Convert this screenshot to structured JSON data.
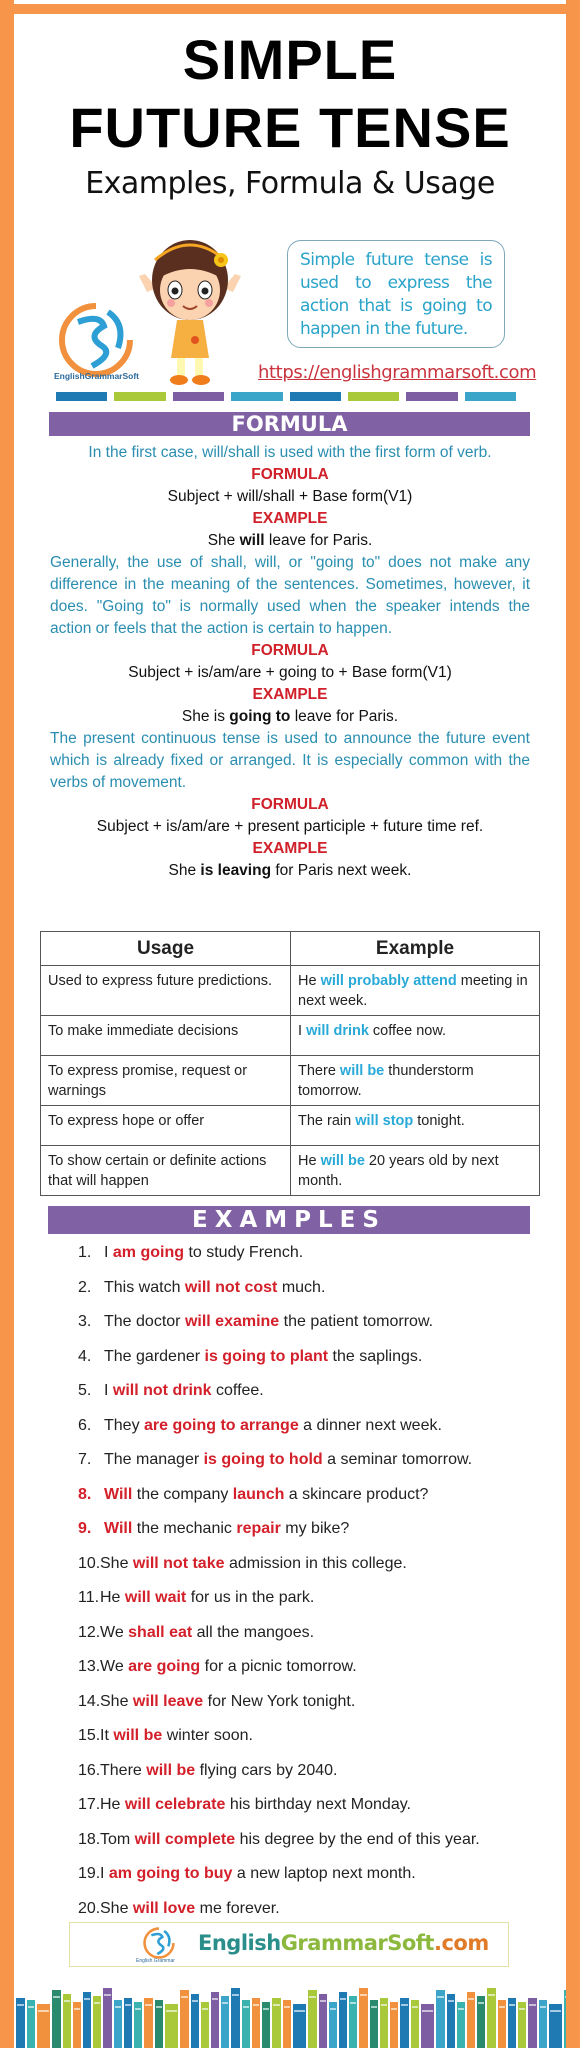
{
  "header": {
    "title_line1": "SIMPLE",
    "title_line2": "FUTURE TENSE",
    "subtitle": "Examples, Formula & Usage"
  },
  "intro": {
    "logo_text": "EnglishGrammarSoft",
    "definition": "Simple future tense is used to express the action that is going to happen in the future.",
    "url": "https://englishgrammarsoft.com",
    "icons": [
      "logo-icon",
      "girl-illustration-icon"
    ]
  },
  "formula_section": {
    "heading": "FORMULA",
    "blocks": [
      {
        "description": "In the first case, will/shall is used with the first form of verb.",
        "formula_label": "FORMULA",
        "formula": "Subject + will/shall + Base form(V1)",
        "example_label": "EXAMPLE",
        "example_parts": [
          "She ",
          "will",
          " leave for Paris."
        ]
      },
      {
        "description": "Generally, the use of shall, will, or \"going to\" does not make any difference in the meaning of the sentences. Sometimes, however, it does. \"Going to\" is normally used when the speaker intends the action or feels that the action is certain to happen.",
        "formula_label": "FORMULA",
        "formula": "Subject + is/am/are + going to + Base form(V1)",
        "example_label": "EXAMPLE",
        "example_parts": [
          "She is ",
          "going to",
          " leave for Paris."
        ]
      },
      {
        "description": "The present continuous tense is used to announce the future event which is already fixed or arranged. It is especially common with the verbs of movement.",
        "formula_label": "FORMULA",
        "formula": "Subject + is/am/are + present participle + future time ref.",
        "example_label": "EXAMPLE",
        "example_parts": [
          "She ",
          "is leaving",
          " for Paris next week."
        ]
      }
    ]
  },
  "usage_table": {
    "headers": [
      "Usage",
      "Example"
    ],
    "rows": [
      {
        "usage": "Used to express future predictions.",
        "example_parts": [
          "He ",
          "will probably attend",
          " meeting in next week."
        ]
      },
      {
        "usage": "To make immediate decisions",
        "example_parts": [
          "I ",
          "will drink",
          " coffee now."
        ]
      },
      {
        "usage": "To express promise, request or warnings",
        "example_parts": [
          "There ",
          "will be",
          " thunderstorm tomorrow."
        ]
      },
      {
        "usage": "To express hope or offer",
        "example_parts": [
          "The rain ",
          "will stop",
          " tonight."
        ]
      },
      {
        "usage": "To show certain or definite actions that will happen",
        "example_parts": [
          "He ",
          "will be",
          " 20 years old by next month."
        ]
      }
    ]
  },
  "examples_section": {
    "heading": "EXAMPLES",
    "items": [
      {
        "num": "1.",
        "parts": [
          "I ",
          "am going",
          " to study French."
        ]
      },
      {
        "num": "2.",
        "parts": [
          "This watch ",
          "will not cost",
          " much."
        ]
      },
      {
        "num": "3.",
        "parts": [
          "The doctor ",
          "will examine",
          " the patient tomorrow."
        ]
      },
      {
        "num": "4.",
        "parts": [
          "The gardener ",
          "is going to plant",
          " the saplings."
        ]
      },
      {
        "num": "5.",
        "parts": [
          "I ",
          "will not drink",
          " coffee."
        ]
      },
      {
        "num": "6.",
        "parts": [
          "They ",
          "are going to arrange",
          " a dinner next week."
        ]
      },
      {
        "num": "7.",
        "parts": [
          "The manager ",
          "is going to hold",
          " a seminar tomorrow."
        ]
      },
      {
        "num": "8.",
        "parts": [
          "",
          "Will",
          " the company ",
          "launch",
          " a skincare product?"
        ],
        "num_red": true
      },
      {
        "num": "9.",
        "parts": [
          "",
          "Will",
          " the mechanic ",
          "repair",
          " my bike?"
        ],
        "num_red": true
      },
      {
        "num": "10.",
        "parts": [
          "She ",
          "will not take",
          " admission in this college."
        ]
      },
      {
        "num": "11.",
        "parts": [
          "He ",
          "will wait",
          " for us in the park."
        ]
      },
      {
        "num": "12.",
        "parts": [
          "We ",
          "shall eat",
          " all the mangoes."
        ]
      },
      {
        "num": "13.",
        "parts": [
          "We ",
          "are going",
          " for a picnic tomorrow."
        ]
      },
      {
        "num": "14.",
        "parts": [
          "She ",
          "will leave",
          " for New York tonight."
        ]
      },
      {
        "num": "15.",
        "parts": [
          "It ",
          "will be",
          " winter soon."
        ]
      },
      {
        "num": "16.",
        "parts": [
          "There ",
          "will be",
          " flying cars by 2040."
        ]
      },
      {
        "num": "17.",
        "parts": [
          "He ",
          "will celebrate",
          " his birthday next Monday."
        ]
      },
      {
        "num": "18.",
        "parts": [
          "Tom ",
          "will complete",
          " his degree by the end of this year."
        ]
      },
      {
        "num": "19.",
        "parts": [
          "I ",
          "am going to buy",
          " a new laptop next month."
        ]
      },
      {
        "num": "20.",
        "parts": [
          "She ",
          "will love",
          " me forever."
        ]
      }
    ]
  },
  "footer": {
    "logo_caption": "English Grammar",
    "brand_part1": "English",
    "brand_part2": "GrammarSoft",
    "brand_part3": ".com"
  },
  "colors": {
    "frame": "#f7964a",
    "band": "#8062a4",
    "highlight_red": "#d3202a",
    "highlight_blue": "#29a9d8",
    "description_blue": "#2a8eb0",
    "stripes": [
      "#1f7ab3",
      "#a9c93a",
      "#7e5ea3",
      "#3aa5c8",
      "#1f7ab3",
      "#a9c93a",
      "#7e5ea3",
      "#3aa5c8"
    ],
    "books": [
      "#1f7ab3",
      "#3ab3b0",
      "#f2913d",
      "#2a8a6e",
      "#a9c93a",
      "#f2913d",
      "#1f7ab3",
      "#a9c93a",
      "#7e5ea3",
      "#3aa5c8"
    ]
  }
}
